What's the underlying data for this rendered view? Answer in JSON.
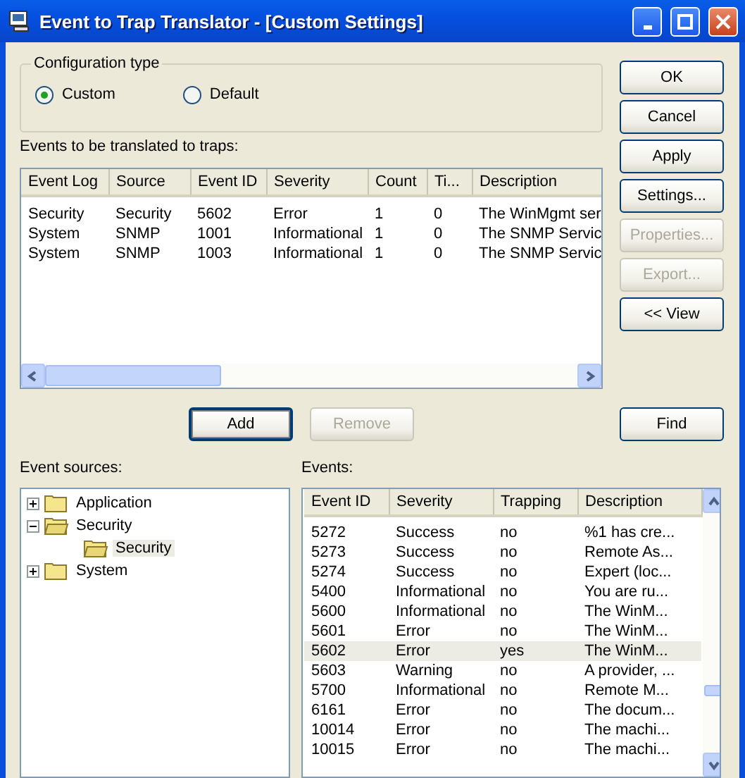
{
  "window": {
    "title": "Event to Trap Translator - [Custom Settings]"
  },
  "configuration_type": {
    "label": "Configuration type",
    "options": [
      {
        "label": "Custom",
        "selected": true
      },
      {
        "label": "Default",
        "selected": false
      }
    ]
  },
  "events_to_translate": {
    "label": "Events to be translated to traps:",
    "columns": [
      "Event Log",
      "Source",
      "Event ID",
      "Severity",
      "Count",
      "Ti...",
      "Description"
    ],
    "rows": [
      [
        "Security",
        "Security",
        "5602",
        "Error",
        "1",
        "0",
        "The WinMgmt ser"
      ],
      [
        "System",
        "SNMP",
        "1001",
        "Informational",
        "1",
        "0",
        "The SNMP Servic"
      ],
      [
        "System",
        "SNMP",
        "1003",
        "Informational",
        "1",
        "0",
        "The SNMP Servic"
      ]
    ]
  },
  "list_buttons": [
    {
      "label": "Add",
      "disabled": false,
      "default": true
    },
    {
      "label": "Remove",
      "disabled": true,
      "default": false
    }
  ],
  "side_buttons": [
    {
      "label": "OK",
      "disabled": false
    },
    {
      "label": "Cancel",
      "disabled": false
    },
    {
      "label": "Apply",
      "disabled": false
    },
    {
      "label": "Settings...",
      "disabled": false
    },
    {
      "label": "Properties...",
      "disabled": true
    },
    {
      "label": "Export...",
      "disabled": true
    },
    {
      "label": "<< View",
      "disabled": false
    }
  ],
  "find_button": {
    "label": "Find"
  },
  "event_sources": {
    "label": "Event sources:",
    "tree": [
      {
        "label": "Application",
        "expanded": false,
        "selected": false
      },
      {
        "label": "Security",
        "expanded": true,
        "selected": false,
        "children": [
          {
            "label": "Security",
            "selected": true
          }
        ]
      },
      {
        "label": "System",
        "expanded": false,
        "selected": false
      }
    ]
  },
  "events": {
    "label": "Events:",
    "columns": [
      "Event ID",
      "Severity",
      "Trapping",
      "Description"
    ],
    "rows": [
      {
        "cells": [
          "5272",
          "Success",
          "no",
          "%1 has cre..."
        ],
        "selected": false
      },
      {
        "cells": [
          "5273",
          "Success",
          "no",
          "Remote As..."
        ],
        "selected": false
      },
      {
        "cells": [
          "5274",
          "Success",
          "no",
          "Expert (loc..."
        ],
        "selected": false
      },
      {
        "cells": [
          "5400",
          "Informational",
          "no",
          "You are ru..."
        ],
        "selected": false
      },
      {
        "cells": [
          "5600",
          "Informational",
          "no",
          "The WinM..."
        ],
        "selected": false
      },
      {
        "cells": [
          "5601",
          "Error",
          "no",
          "The WinM..."
        ],
        "selected": false
      },
      {
        "cells": [
          "5602",
          "Error",
          "yes",
          "The WinM..."
        ],
        "selected": true
      },
      {
        "cells": [
          "5603",
          "Warning",
          "no",
          "A provider, ..."
        ],
        "selected": false
      },
      {
        "cells": [
          "5700",
          "Informational",
          "no",
          "Remote M..."
        ],
        "selected": false
      },
      {
        "cells": [
          "6161",
          "Error",
          "no",
          "The docum..."
        ],
        "selected": false
      },
      {
        "cells": [
          "10014",
          "Error",
          "no",
          "The machi..."
        ],
        "selected": false
      },
      {
        "cells": [
          "10015",
          "Error",
          "no",
          "The machi..."
        ],
        "selected": false
      }
    ]
  }
}
